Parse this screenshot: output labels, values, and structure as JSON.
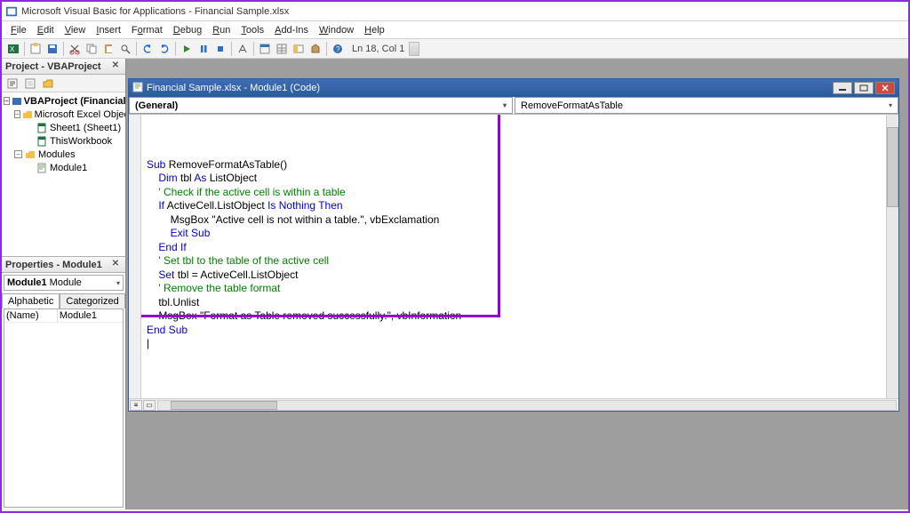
{
  "window": {
    "title": "Microsoft Visual Basic for Applications - Financial Sample.xlsx"
  },
  "menu": [
    "File",
    "Edit",
    "View",
    "Insert",
    "Format",
    "Debug",
    "Run",
    "Tools",
    "Add-Ins",
    "Window",
    "Help"
  ],
  "toolbar_status": "Ln 18, Col 1",
  "project_panel": {
    "title": "Project - VBAProject",
    "tree": {
      "root": "VBAProject (Financial Sample.xlsx)",
      "excel_objects": "Microsoft Excel Objects",
      "sheet1": "Sheet1 (Sheet1)",
      "workbook": "ThisWorkbook",
      "modules": "Modules",
      "module1": "Module1"
    }
  },
  "properties_panel": {
    "title": "Properties - Module1",
    "combo": "Module1 Module",
    "tabs": {
      "alpha": "Alphabetic",
      "cat": "Categorized"
    },
    "rows": [
      {
        "name": "(Name)",
        "value": "Module1"
      }
    ]
  },
  "code_window": {
    "title": "Financial Sample.xlsx - Module1 (Code)",
    "left_combo": "(General)",
    "right_combo": "RemoveFormatAsTable",
    "lines": [
      {
        "segs": [
          {
            "t": "Sub ",
            "c": "kw"
          },
          {
            "t": "RemoveFormatAsTable()"
          }
        ]
      },
      {
        "segs": [
          {
            "t": "    "
          },
          {
            "t": "Dim ",
            "c": "kw"
          },
          {
            "t": "tbl "
          },
          {
            "t": "As ",
            "c": "kw"
          },
          {
            "t": "ListObject"
          }
        ]
      },
      {
        "segs": [
          {
            "t": ""
          }
        ]
      },
      {
        "segs": [
          {
            "t": "    "
          },
          {
            "t": "' Check if the active cell is within a table",
            "c": "cmt"
          }
        ]
      },
      {
        "segs": [
          {
            "t": "    "
          },
          {
            "t": "If ",
            "c": "kw"
          },
          {
            "t": "ActiveCell.ListObject "
          },
          {
            "t": "Is Nothing Then",
            "c": "kw"
          }
        ]
      },
      {
        "segs": [
          {
            "t": "        MsgBox \"Active cell is not within a table.\", vbExclamation"
          }
        ]
      },
      {
        "segs": [
          {
            "t": "        "
          },
          {
            "t": "Exit Sub",
            "c": "kw"
          }
        ]
      },
      {
        "segs": [
          {
            "t": "    "
          },
          {
            "t": "End If",
            "c": "kw"
          }
        ]
      },
      {
        "segs": [
          {
            "t": ""
          }
        ]
      },
      {
        "segs": [
          {
            "t": "    "
          },
          {
            "t": "' Set tbl to the table of the active cell",
            "c": "cmt"
          }
        ]
      },
      {
        "segs": [
          {
            "t": "    "
          },
          {
            "t": "Set ",
            "c": "kw"
          },
          {
            "t": "tbl = ActiveCell.ListObject"
          }
        ]
      },
      {
        "segs": [
          {
            "t": ""
          }
        ]
      },
      {
        "segs": [
          {
            "t": "    "
          },
          {
            "t": "' Remove the table format",
            "c": "cmt"
          }
        ]
      },
      {
        "segs": [
          {
            "t": "    tbl.Unlist"
          }
        ]
      },
      {
        "segs": [
          {
            "t": ""
          }
        ]
      },
      {
        "segs": [
          {
            "t": "    MsgBox \"Format as Table removed successfully.\", vbInformation"
          }
        ]
      },
      {
        "segs": [
          {
            "t": "End Sub",
            "c": "kw"
          }
        ]
      },
      {
        "segs": [
          {
            "t": "|"
          }
        ]
      }
    ]
  }
}
